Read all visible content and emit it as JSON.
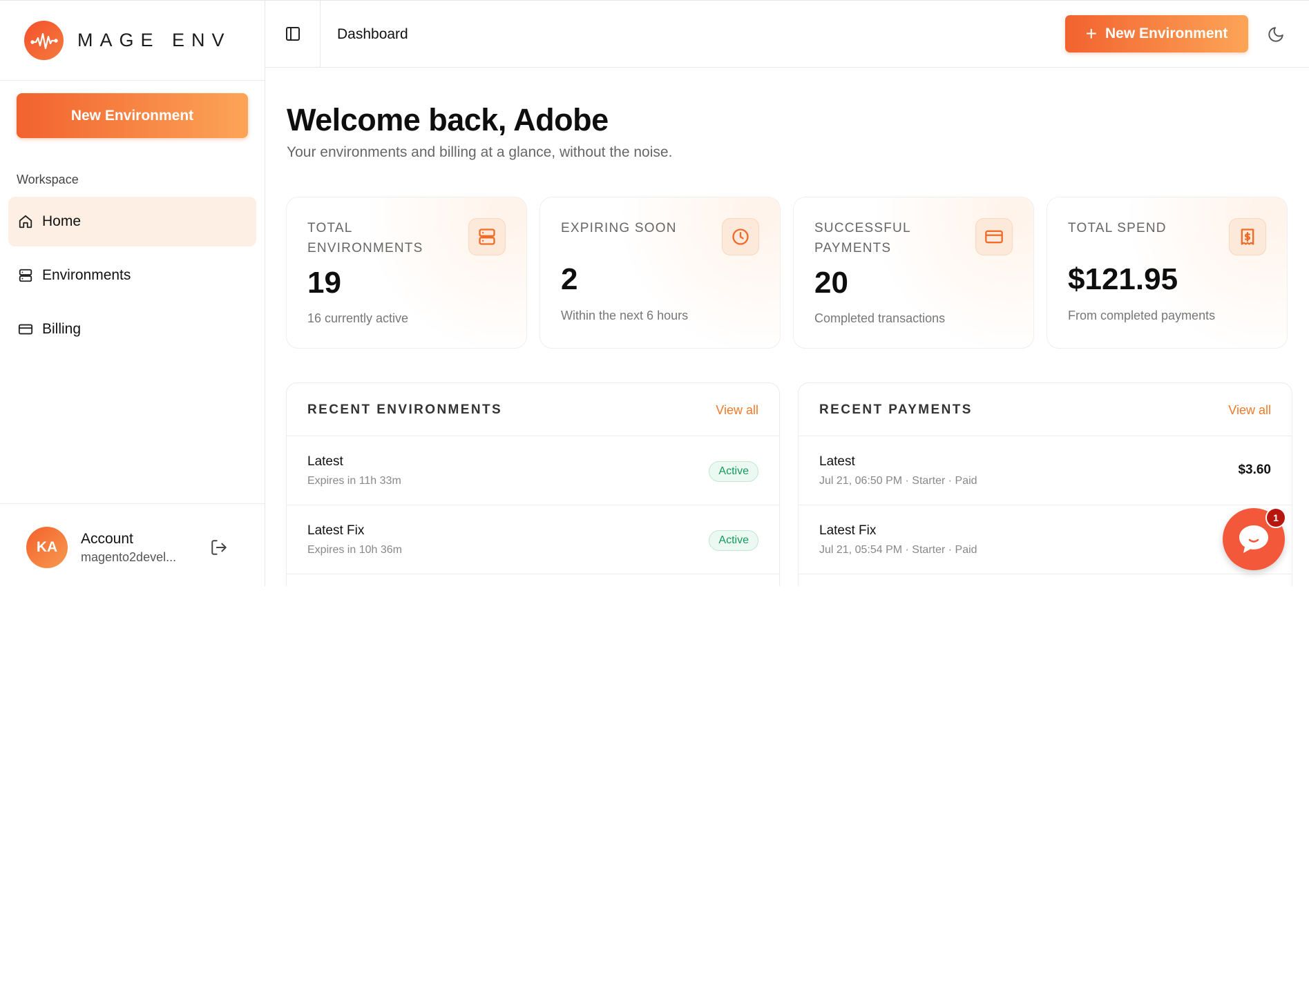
{
  "brand": {
    "name": "MAGE ENV",
    "logo_icon": "waveform-icon"
  },
  "sidebar": {
    "new_button": "New Environment",
    "section_label": "Workspace",
    "items": [
      {
        "label": "Home",
        "icon": "home-icon",
        "active": true
      },
      {
        "label": "Environments",
        "icon": "server-icon",
        "active": false
      },
      {
        "label": "Billing",
        "icon": "credit-card-icon",
        "active": false
      }
    ],
    "account": {
      "initials": "KA",
      "title": "Account",
      "email": "magento2devel..."
    }
  },
  "header": {
    "title": "Dashboard",
    "new_button": "New Environment",
    "new_button_icon": "+"
  },
  "welcome": {
    "title": "Welcome back, Adobe",
    "subtitle": "Your environments and billing at a glance, without the noise."
  },
  "stats": [
    {
      "label": "TOTAL ENVIRONMENTS",
      "value": "19",
      "desc": "16 currently active",
      "icon": "server-icon"
    },
    {
      "label": "EXPIRING SOON",
      "value": "2",
      "desc": "Within the next 6 hours",
      "icon": "clock-icon"
    },
    {
      "label": "SUCCESSFUL PAYMENTS",
      "value": "20",
      "desc": "Completed transactions",
      "icon": "credit-card-icon"
    },
    {
      "label": "TOTAL SPEND",
      "value": "$121.95",
      "desc": "From completed payments",
      "icon": "receipt-icon"
    }
  ],
  "recent_environments": {
    "title": "RECENT ENVIRONMENTS",
    "view_all": "View all",
    "rows": [
      {
        "name": "Latest",
        "expires": "Expires in 11h 33m",
        "status": "Active"
      },
      {
        "name": "Latest Fix",
        "expires": "Expires in 10h 36m",
        "status": "Active"
      }
    ]
  },
  "recent_payments": {
    "title": "RECENT PAYMENTS",
    "view_all": "View all",
    "rows": [
      {
        "name": "Latest",
        "meta": "Jul 21, 06:50 PM · Starter · Paid",
        "amount": "$3.60"
      },
      {
        "name": "Latest Fix",
        "meta": "Jul 21, 05:54 PM · Starter · Paid",
        "amount": ""
      }
    ]
  },
  "chat": {
    "unread_count": "1"
  },
  "colors": {
    "accent": "#f2622f",
    "accent_light": "#fca557",
    "success": "#119a5a",
    "active_nav_bg": "#fdefe4"
  }
}
